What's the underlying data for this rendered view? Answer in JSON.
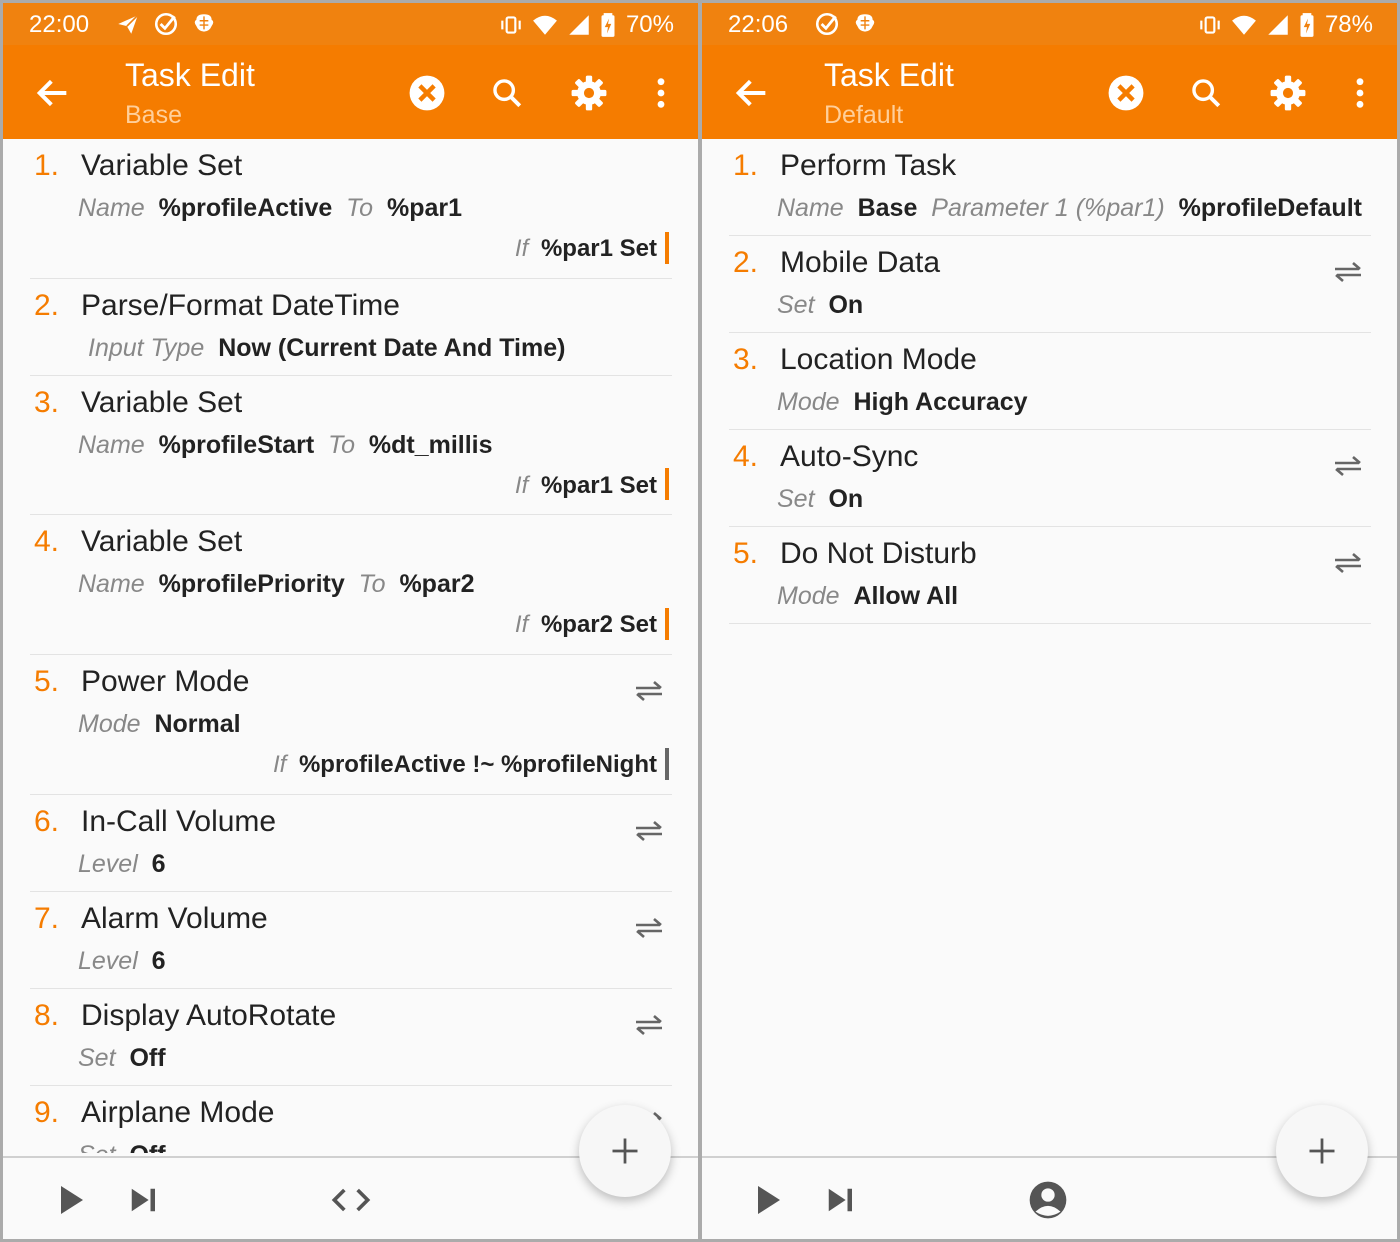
{
  "colors": {
    "accent": "#f57c00",
    "statusbar": "#f0820f",
    "param_key": "#888888",
    "condition_bar": "#f57c00"
  },
  "left": {
    "status": {
      "time": "22:00",
      "battery": "70%",
      "icons": [
        "send-icon",
        "check-circle-icon",
        "brain-icon"
      ]
    },
    "app_bar": {
      "title": "Task Edit",
      "subtitle": "Base"
    },
    "actions": [
      {
        "num": "1.",
        "name": "Variable Set",
        "params": [
          {
            "k": "Name",
            "v": "%profileActive"
          },
          {
            "k": "To",
            "v": "%par1"
          }
        ],
        "if_label": "If",
        "condition": "%par1 Set",
        "swap": false
      },
      {
        "num": "2.",
        "name": "Parse/Format DateTime",
        "params": [
          {
            "k": "Input Type",
            "v": "Now (Current Date And Time)"
          }
        ],
        "swap": false
      },
      {
        "num": "3.",
        "name": "Variable Set",
        "params": [
          {
            "k": "Name",
            "v": "%profileStart"
          },
          {
            "k": "To",
            "v": "%dt_millis"
          }
        ],
        "if_label": "If",
        "condition": "%par1 Set",
        "swap": false
      },
      {
        "num": "4.",
        "name": "Variable Set",
        "params": [
          {
            "k": "Name",
            "v": "%profilePriority"
          },
          {
            "k": "To",
            "v": "%par2"
          }
        ],
        "if_label": "If",
        "condition": "%par2 Set",
        "swap": false
      },
      {
        "num": "5.",
        "name": "Power Mode",
        "params": [
          {
            "k": "Mode",
            "v": "Normal"
          }
        ],
        "if_label": "If",
        "condition": "%profileActive !~ %profileNight",
        "condition_grey": true,
        "swap": true
      },
      {
        "num": "6.",
        "name": "In-Call Volume",
        "params": [
          {
            "k": "Level",
            "v": "6"
          }
        ],
        "swap": true
      },
      {
        "num": "7.",
        "name": "Alarm Volume",
        "params": [
          {
            "k": "Level",
            "v": "6"
          }
        ],
        "swap": true
      },
      {
        "num": "8.",
        "name": "Display AutoRotate",
        "params": [
          {
            "k": "Set",
            "v": "Off"
          }
        ],
        "swap": true
      },
      {
        "num": "9.",
        "name": "Airplane Mode",
        "params": [
          {
            "k": "Set",
            "v": "Off"
          }
        ],
        "swap": true
      }
    ],
    "bottom_bar": [
      "play-icon",
      "step-icon",
      "code-icon"
    ]
  },
  "right": {
    "status": {
      "time": "22:06",
      "battery": "78%",
      "icons": [
        "check-circle-icon",
        "brain-icon"
      ]
    },
    "app_bar": {
      "title": "Task Edit",
      "subtitle": "Default"
    },
    "actions": [
      {
        "num": "1.",
        "name": "Perform Task",
        "params": [
          {
            "k": "Name",
            "v": "Base"
          },
          {
            "k": "Parameter 1 (%par1)",
            "v": "%profileDefault"
          }
        ],
        "swap": false
      },
      {
        "num": "2.",
        "name": "Mobile Data",
        "params": [
          {
            "k": "Set",
            "v": "On"
          }
        ],
        "swap": true
      },
      {
        "num": "3.",
        "name": "Location Mode",
        "params": [
          {
            "k": "Mode",
            "v": "High Accuracy"
          }
        ],
        "swap": false
      },
      {
        "num": "4.",
        "name": "Auto-Sync",
        "params": [
          {
            "k": "Set",
            "v": "On"
          }
        ],
        "swap": true
      },
      {
        "num": "5.",
        "name": "Do Not Disturb",
        "params": [
          {
            "k": "Mode",
            "v": "Allow All"
          }
        ],
        "swap": true
      }
    ],
    "bottom_bar": [
      "play-icon",
      "step-icon",
      "account-icon"
    ]
  }
}
